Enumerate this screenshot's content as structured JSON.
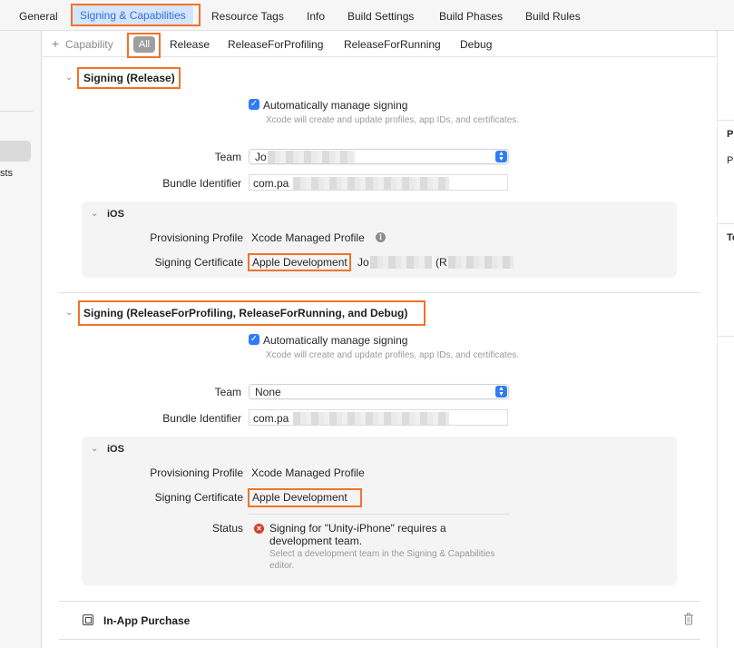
{
  "tabs": [
    {
      "label": "General"
    },
    {
      "label": "Signing & Capabilities",
      "active": true
    },
    {
      "label": "Resource Tags"
    },
    {
      "label": "Info"
    },
    {
      "label": "Build Settings"
    },
    {
      "label": "Build Phases"
    },
    {
      "label": "Build Rules"
    }
  ],
  "sidebar": {
    "partial_text": "sts"
  },
  "right_pane": {
    "label_1": "Pr",
    "label_2": "Pr",
    "label_3": "To"
  },
  "filter": {
    "add_capability": "Capability",
    "add_symbol": "+",
    "items": [
      "All",
      "Release",
      "ReleaseForProfiling",
      "ReleaseForRunning",
      "Debug"
    ]
  },
  "release": {
    "title": "Signing (Release)",
    "auto_manage": "Automatically manage signing",
    "auto_hint": "Xcode will create and update profiles, app IDs, and certificates.",
    "team_label": "Team",
    "team_value": "Jo",
    "bundle_label": "Bundle Identifier",
    "bundle_value": "com.pa",
    "ios": {
      "title": "iOS",
      "prov_label": "Provisioning Profile",
      "prov_value": "Xcode Managed Profile",
      "cert_label": "Signing Certificate",
      "cert_value": "Apple Development",
      "cert_owner": "Jo",
      "cert_paren": "(R"
    }
  },
  "debug": {
    "title": "Signing (ReleaseForProfiling, ReleaseForRunning, and Debug)",
    "auto_manage": "Automatically manage signing",
    "auto_hint": "Xcode will create and update profiles, app IDs, and certificates.",
    "team_label": "Team",
    "team_value": "None",
    "bundle_label": "Bundle Identifier",
    "bundle_value": "com.pa",
    "ios": {
      "title": "iOS",
      "prov_label": "Provisioning Profile",
      "prov_value": "Xcode Managed Profile",
      "cert_label": "Signing Certificate",
      "cert_value": "Apple Development",
      "status_label": "Status",
      "status_message": "Signing for \"Unity-iPhone\" requires a development team.",
      "status_hint": "Select a development team in the Signing & Capabilities editor."
    }
  },
  "iap": {
    "title": "In-App Purchase"
  },
  "colors": {
    "accent": "#2f7bf6",
    "highlight": "#f0732a",
    "error": "#d63a2c"
  }
}
